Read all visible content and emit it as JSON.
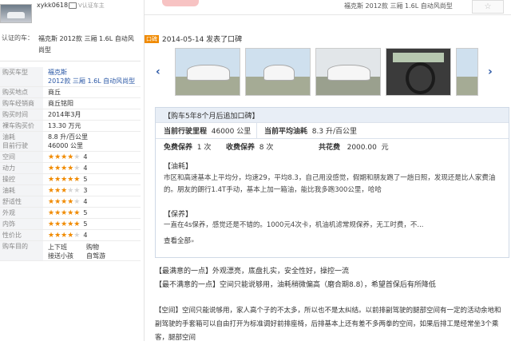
{
  "user": {
    "name": "xykk0618",
    "cert_label": "V认证车主"
  },
  "certified_car": {
    "label": "认证的车：",
    "value": "福克斯 2012款 三厢 1.6L 自动风尚型"
  },
  "spec": [
    {
      "key": "购买车型",
      "value": "福克斯\n2012款 三厢 1.6L 自动风尚型"
    },
    {
      "key": "购买地点",
      "value": "商丘"
    },
    {
      "key": "购车经销商",
      "value": "商丘铭阳"
    },
    {
      "key": "购买时间",
      "value": "2014年3月"
    },
    {
      "key": "裸车购买价",
      "value": "13.30 万元"
    },
    {
      "key": "油耗\n目前行驶",
      "value": "8.8 升/百公里\n46000 公里"
    }
  ],
  "ratings": [
    {
      "key": "空间",
      "stars": 4,
      "score": "4"
    },
    {
      "key": "动力",
      "stars": 4,
      "score": "4"
    },
    {
      "key": "操控",
      "stars": 5,
      "score": "5"
    },
    {
      "key": "油耗",
      "stars": 3,
      "score": "3"
    },
    {
      "key": "舒适性",
      "stars": 4,
      "score": "4"
    },
    {
      "key": "外观",
      "stars": 5,
      "score": "5"
    },
    {
      "key": "内饰",
      "stars": 5,
      "score": "5"
    },
    {
      "key": "性价比",
      "stars": 4,
      "score": "4"
    }
  ],
  "purpose": {
    "key": "购车目的",
    "items": [
      "上下班",
      "购物",
      "接送小孩",
      "自驾游"
    ]
  },
  "header": {
    "breadcrumb": "福克斯 2012款 三厢 1.6L 自动风尚型",
    "star_icon": "☆"
  },
  "post": {
    "tag": "口碑",
    "date_text": "2014-05-14 发表了口碑"
  },
  "gallery": {
    "prev_icon": "‹",
    "next_icon": "›"
  },
  "followup": {
    "header": "【购车5年8个月后追加口碑】",
    "current_mileage": {
      "label": "当前行驶里程",
      "value": "46000",
      "unit": "公里"
    },
    "avg_fuel": {
      "label": "当前平均油耗",
      "value": "8.3",
      "unit": "升/百公里"
    },
    "free_maint": {
      "label": "免费保养",
      "value": "1",
      "unit": "次"
    },
    "paid_maint": {
      "label": "收费保养",
      "value": "8",
      "unit": "次"
    },
    "total_cost": {
      "label": "共花费",
      "value": "2000.00",
      "unit": "元"
    },
    "fuel_title": "【油耗】",
    "fuel_text": "市区和高速基本上平均分，均速29，平均8.3，自己用没感觉，假期和朋友跑了一趟日照，发现还是比人家费油的。朋友的朗行1.4T手动，基本上加一箱油，能比我多跑300公里，哈哈",
    "maint_title": "【保养】",
    "maint_text": "一直在4s保养，感觉还是不错的。1000元4次卡，机油机滤常规保养，无工时费，不...",
    "more_label": "查看全部",
    "more_icon": "»"
  },
  "best": {
    "label": "【最满意的一点】",
    "text": "外观漂亮，底盘扎实，安全性好，操控一流"
  },
  "worst": {
    "label": "【最不满意的一点】",
    "text": "空间只能说够用，油耗稍微偏高（磨合期8.8），希望首保后有所降低"
  },
  "space": {
    "label": "【空间】",
    "text": "空间只能说够用，家人高个子的不太多，所以也不是太纠结。以前排副驾驶的腿部空间有一定的活动余地和副驾驶的手套箱可以自由打开为标准调好前排座椅，后排基本上还有差不多两拳的空间，如果后排工是经常坐3个乘客，腿部空间"
  }
}
